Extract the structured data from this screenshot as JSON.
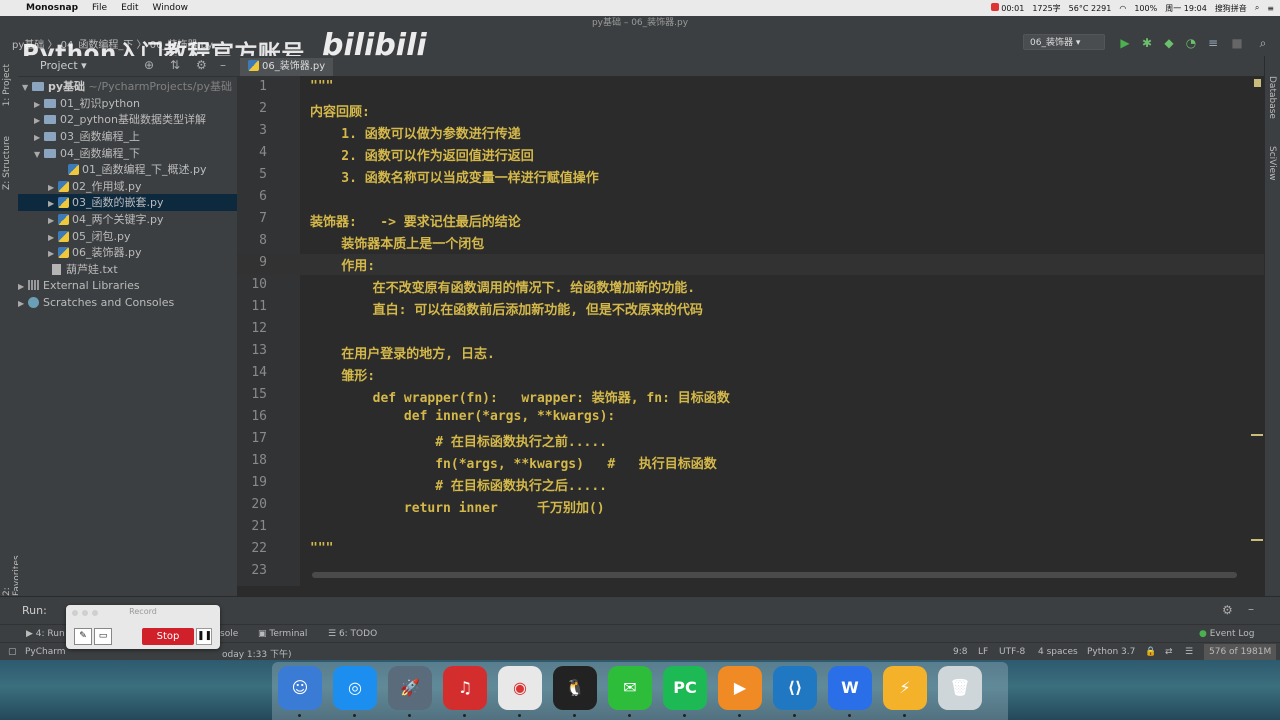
{
  "menubar": {
    "app_name": "Monosnap",
    "items": [
      "File",
      "Edit",
      "Window"
    ],
    "record_time": "00:01",
    "word_count": "1725字",
    "cpu": "56°C 2291",
    "battery": "100%",
    "clock": "周一 19:04",
    "input_method": "搜狗拼音"
  },
  "window": {
    "title": "py基础 – 06_装饰器.py"
  },
  "toolbar": {
    "breadcrumb": "py基础 〉 04_函数编程_下 〉 06_装饰器.py",
    "run_config": "06_装饰器"
  },
  "watermark": {
    "text": "Python入门教程官方账号",
    "brand": "bilibili"
  },
  "left_strip": {
    "project_tab": "1: Project",
    "structure_tab": "Z: Structure",
    "favorites_tab": "2: Favorites"
  },
  "right_strip": {
    "database_tab": "Database",
    "sciview_tab": "SciView"
  },
  "project_panel": {
    "label": "Project",
    "root_name": "py基础",
    "root_path": "~/PycharmProjects/py基础",
    "folders": [
      "01_初识python",
      "02_python基础数据类型详解",
      "03_函数编程_上",
      "04_函数编程_下"
    ],
    "files": [
      "01_函数编程_下_概述.py",
      "02_作用域.py",
      "03_函数的嵌套.py",
      "04_两个关键字.py",
      "05_闭包.py",
      "06_装饰器.py"
    ],
    "txt_file": "葫芦娃.txt",
    "external": "External Libraries",
    "scratches": "Scratches and Consoles"
  },
  "editor": {
    "tab_label": "06_装饰器.py",
    "line_numbers": [
      "1",
      "2",
      "3",
      "4",
      "5",
      "6",
      "7",
      "8",
      "9",
      "10",
      "11",
      "12",
      "13",
      "14",
      "15",
      "16",
      "17",
      "18",
      "19",
      "20",
      "21",
      "22",
      "23"
    ],
    "lines": [
      "\"\"\"",
      "内容回顾:",
      "    1. 函数可以做为参数进行传递",
      "    2. 函数可以作为返回值进行返回",
      "    3. 函数名称可以当成变量一样进行赋值操作",
      "",
      "装饰器:   -> 要求记住最后的结论",
      "    装饰器本质上是一个闭包",
      "    作用:",
      "        在不改变原有函数调用的情况下. 给函数增加新的功能.",
      "        直白: 可以在函数前后添加新功能, 但是不改原来的代码",
      "",
      "    在用户登录的地方, 日志.",
      "    雏形:",
      "        def wrapper(fn):   wrapper: 装饰器, fn: 目标函数",
      "            def inner(*args, **kwargs):",
      "                # 在目标函数执行之前.....",
      "                fn(*args, **kwargs)   #   执行目标函数",
      "                # 在目标函数执行之后.....",
      "            return inner     千万别加()",
      "",
      "\"\"\"",
      ""
    ]
  },
  "run_panel": {
    "label": "Run:"
  },
  "bottom_tabs": {
    "run": "4: Run",
    "console": "sole",
    "terminal": "Terminal",
    "todo": "6: TODO",
    "event_log": "Event Log"
  },
  "record_widget": {
    "title": "Record",
    "stop_label": "Stop"
  },
  "status_bar": {
    "left_text": "PyCharm",
    "left_tail": "oday 1:33 下午)",
    "position": "9:8",
    "line_sep": "LF",
    "encoding": "UTF-8",
    "indent": "4 spaces",
    "interpreter": "Python 3.7",
    "memory": "576 of 1981M"
  },
  "dock": {
    "apps": [
      "finder-icon",
      "safari-icon",
      "launchpad-icon",
      "netease-music-icon",
      "chrome-icon",
      "qq-icon",
      "wechat-icon",
      "pycharm-icon",
      "infuse-icon",
      "vscode-icon",
      "wps-icon",
      "monosnap-icon",
      "trash-icon"
    ]
  },
  "colors": {
    "code_yellow": "#d4b84a",
    "editor_bg": "#2b2b2b",
    "panel_bg": "#3c3f41",
    "selection": "#0d293e"
  }
}
